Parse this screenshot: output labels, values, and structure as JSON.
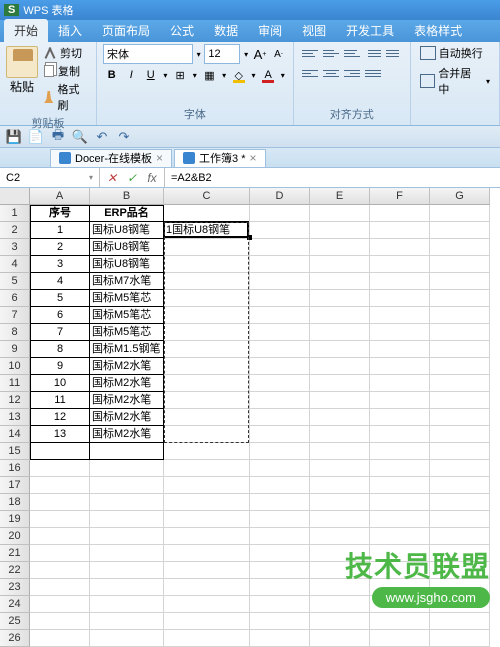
{
  "app": {
    "title": "WPS 表格"
  },
  "tabs": [
    "开始",
    "插入",
    "页面布局",
    "公式",
    "数据",
    "审阅",
    "视图",
    "开发工具",
    "表格样式"
  ],
  "activeTab": 0,
  "clipboard": {
    "label": "剪贴板",
    "paste": "粘贴",
    "cut": "剪切",
    "copy": "复制",
    "format": "格式刷"
  },
  "font": {
    "label": "字体",
    "name": "宋体",
    "size": "12",
    "aplus": "A",
    "aminus": "A"
  },
  "align": {
    "label": "对齐方式",
    "wrap": "自动换行",
    "merge": "合并居中"
  },
  "docTabs": [
    {
      "label": "Docer-在线模板",
      "active": false
    },
    {
      "label": "工作簿3 *",
      "active": true
    }
  ],
  "cellRef": "C2",
  "formula": "=A2&B2",
  "columns": [
    "A",
    "B",
    "C",
    "D",
    "E",
    "F",
    "G"
  ],
  "headers": {
    "col1": "序号",
    "col2": "ERP品名"
  },
  "rows": [
    {
      "seq": "1",
      "name": "国标U8钢笔"
    },
    {
      "seq": "2",
      "name": "国标U8钢笔"
    },
    {
      "seq": "3",
      "name": "国标U8钢笔"
    },
    {
      "seq": "4",
      "name": "国标M7水笔"
    },
    {
      "seq": "5",
      "name": "国标M5笔芯"
    },
    {
      "seq": "6",
      "name": "国标M5笔芯"
    },
    {
      "seq": "7",
      "name": "国标M5笔芯"
    },
    {
      "seq": "8",
      "name": "国标M1.5钢笔"
    },
    {
      "seq": "9",
      "name": "国标M2水笔"
    },
    {
      "seq": "10",
      "name": "国标M2水笔"
    },
    {
      "seq": "11",
      "name": "国标M2水笔"
    },
    {
      "seq": "12",
      "name": "国标M2水笔"
    },
    {
      "seq": "13",
      "name": "国标M2水笔"
    }
  ],
  "c2value": "1国标U8钢笔",
  "rowCount": 26,
  "watermark": {
    "text": "技术员联盟",
    "url": "www.jsgho.com"
  }
}
